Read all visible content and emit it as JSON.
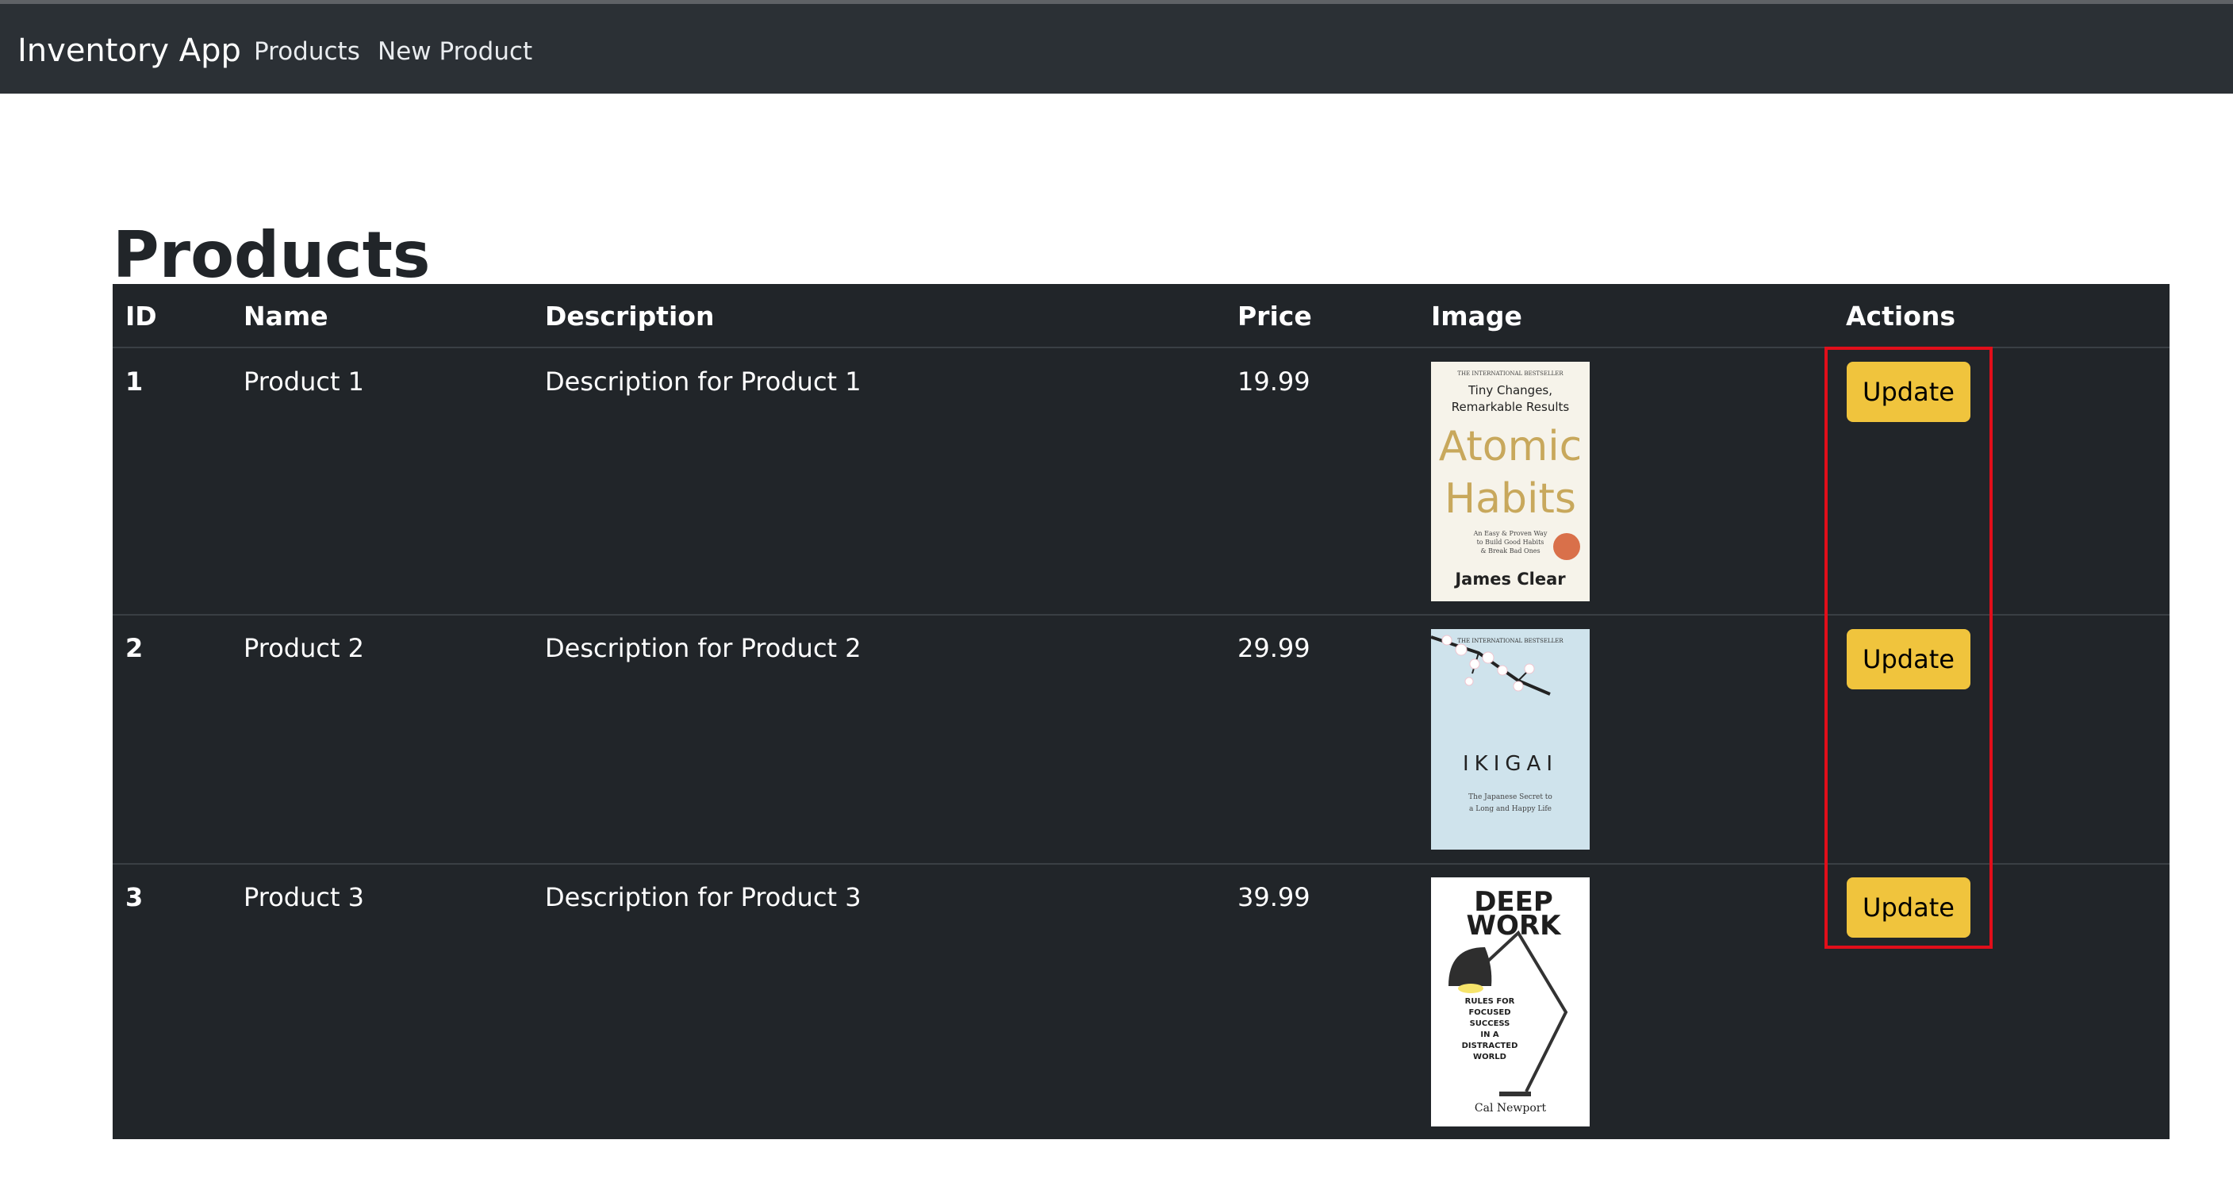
{
  "navbar": {
    "brand": "Inventory App",
    "links": [
      {
        "label": "Products"
      },
      {
        "label": "New Product"
      }
    ]
  },
  "page": {
    "title": "Products"
  },
  "table": {
    "headers": [
      "ID",
      "Name",
      "Description",
      "Price",
      "Image",
      "Actions"
    ],
    "rows": [
      {
        "id": "1",
        "name": "Product 1",
        "description": "Description for Product 1",
        "price": "19.99",
        "action": "Update",
        "image_icon": "atomic-habits-book-cover"
      },
      {
        "id": "2",
        "name": "Product 2",
        "description": "Description for Product 2",
        "price": "29.99",
        "action": "Update",
        "image_icon": "ikigai-book-cover"
      },
      {
        "id": "3",
        "name": "Product 3",
        "description": "Description for Product 3",
        "price": "39.99",
        "action": "Update",
        "image_icon": "deep-work-book-cover"
      }
    ]
  },
  "book_covers": {
    "atomic_habits": {
      "top": "THE INTERNATIONAL BESTSELLER",
      "tagline1": "Tiny Changes,",
      "tagline2": "Remarkable Results",
      "title1": "Atomic",
      "title2": "Habits",
      "sub1": "An Easy & Proven Way",
      "sub2": "to Build Good Habits",
      "sub3": "& Break Bad Ones",
      "author": "James Clear"
    },
    "ikigai": {
      "top": "THE INTERNATIONAL BESTSELLER",
      "title": "IKIGAI",
      "sub1": "The Japanese Secret to",
      "sub2": "a Long and Happy Life"
    },
    "deep_work": {
      "title1": "DEEP",
      "title2": "WORK",
      "sub1": "RULES FOR",
      "sub2": "FOCUSED",
      "sub3": "SUCCESS",
      "sub4": "IN A",
      "sub5": "DISTRACTED",
      "sub6": "WORLD",
      "author": "Cal Newport"
    }
  },
  "colors": {
    "navbar_bg": "#2b3035",
    "table_bg": "#212529",
    "button_warning": "#f0c43d",
    "highlight_red": "#e10e1a"
  }
}
